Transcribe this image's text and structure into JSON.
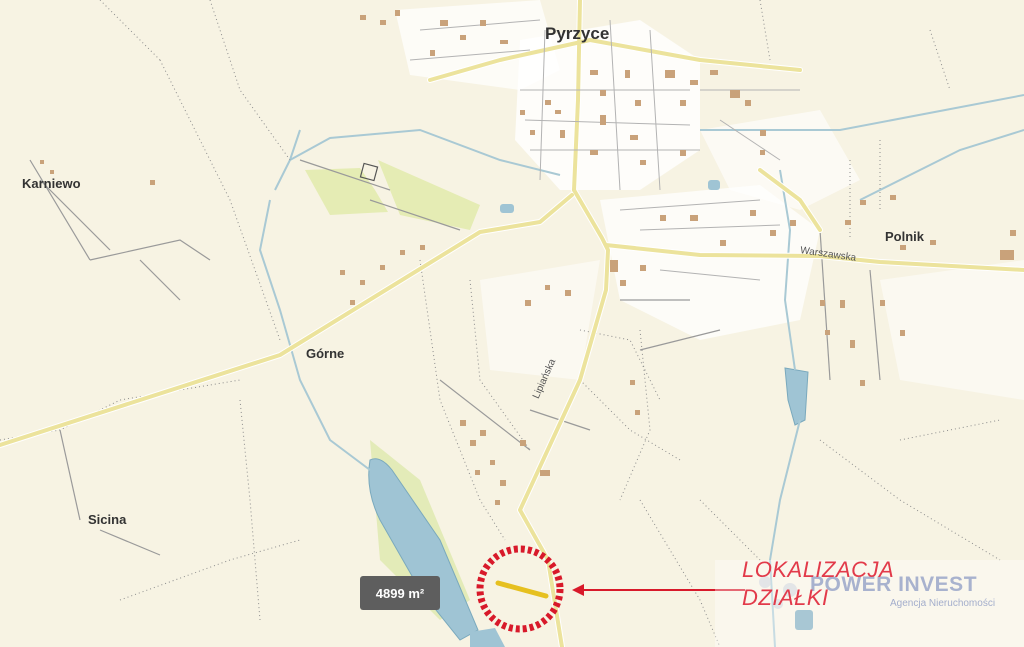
{
  "map": {
    "places": {
      "pyrzyce": "Pyrzyce",
      "karniewo": "Karniewo",
      "gorne": "Górne",
      "polnik": "Polnik",
      "sicina": "Sicina"
    },
    "streets": {
      "warszawska": "Warszawska",
      "lipianska": "Lipiańska"
    },
    "area_label": "4899 m²",
    "callout": {
      "line1": "LOKALIZACJA",
      "line2": "DZIAŁKI",
      "color": "#e23a4a"
    },
    "watermark": {
      "name": "POWER INVEST",
      "tagline": "Agencja Nieruchomości"
    },
    "colors": {
      "background": "#f7f3e3",
      "road": "#ece39c",
      "water": "#9fc4d4",
      "building": "#c9a27a",
      "parcel": "#e6c020",
      "marker": "#d8192a"
    }
  }
}
